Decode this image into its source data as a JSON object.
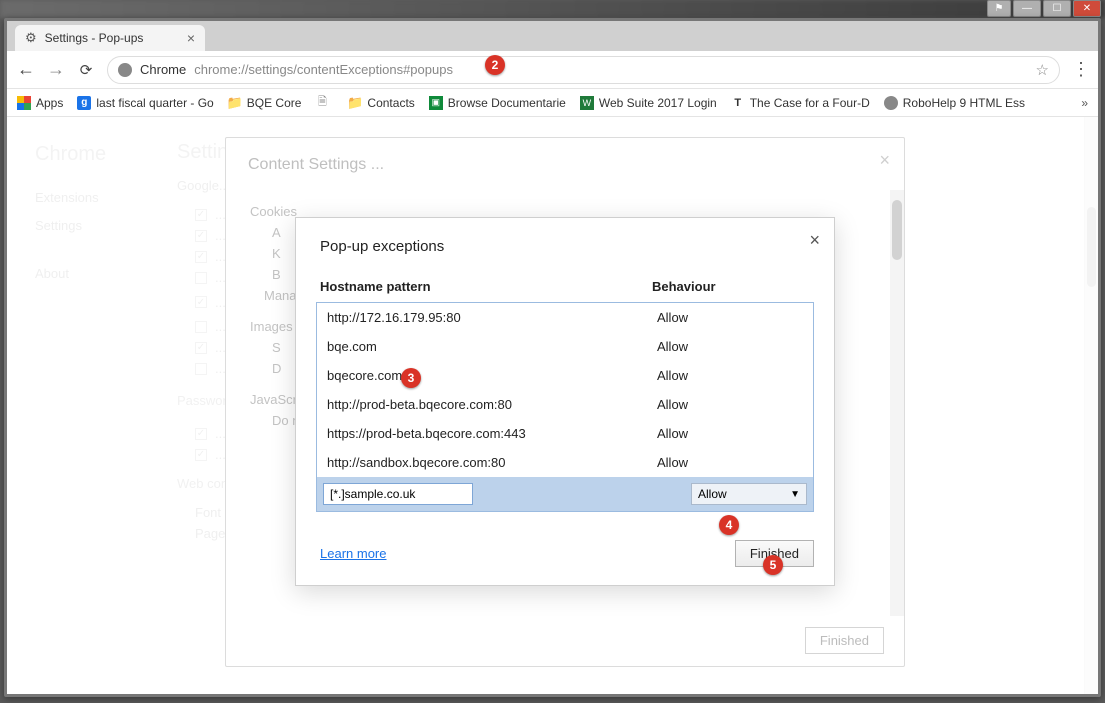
{
  "window_controls": {
    "user": "⚑",
    "min": "—",
    "max": "☐",
    "close": "✕"
  },
  "tab": {
    "title": "Settings - Pop-ups"
  },
  "nav": {
    "back": "←",
    "fwd": "→",
    "reload": "⟳"
  },
  "omnibox": {
    "label": "Chrome",
    "url": "chrome://settings/contentExceptions#popups",
    "star": "☆"
  },
  "menu_icon": "⋮",
  "bookmarks": {
    "apps": "Apps",
    "items": [
      "last fiscal quarter - Go",
      "BQE Core",
      "",
      "Contacts",
      "Browse Documentarie",
      "Web Suite 2017 Login",
      "The Case for a Four-D",
      "RoboHelp 9 HTML Ess"
    ],
    "overflow": "»"
  },
  "settings_bg": {
    "brand": "Chrome",
    "heading": "Settings",
    "nav": [
      "Extensions",
      "Settings",
      "About"
    ],
    "signin": "Google...",
    "sections": {
      "cookies": "Cookies",
      "images": "Images",
      "passwords": "Passwords",
      "javascript": "JavaScript",
      "webcon": "Web content",
      "fontsize": "Font size",
      "zoom": "Page zoom"
    },
    "manage": "Manage",
    "jsopt": "Do not allow any site to run JavaScript"
  },
  "modal1": {
    "title": "Content Settings ...",
    "cookies": "Cookies",
    "opts": [
      "A",
      "K",
      "B"
    ],
    "images": "Images",
    "img_opts": [
      "S",
      "D"
    ],
    "javascript": "JavaScript",
    "js_opt": "Do not allow any site to run JavaScript",
    "finished": "Finished"
  },
  "modal2": {
    "title": "Pop-up exceptions",
    "col_host": "Hostname pattern",
    "col_beh": "Behaviour",
    "rows": [
      {
        "host": "http://172.16.179.95:80",
        "beh": "Allow"
      },
      {
        "host": "bqe.com",
        "beh": "Allow"
      },
      {
        "host": "bqecore.com",
        "beh": "Allow"
      },
      {
        "host": "http://prod-beta.bqecore.com:80",
        "beh": "Allow"
      },
      {
        "host": "https://prod-beta.bqecore.com:443",
        "beh": "Allow"
      },
      {
        "host": "http://sandbox.bqecore.com:80",
        "beh": "Allow"
      }
    ],
    "new_value": "[*.]sample.co.uk",
    "new_select": "Allow",
    "learn": "Learn more",
    "submit": "Finished"
  },
  "annotations": {
    "a2": "2",
    "a3": "3",
    "a4": "4",
    "a5": "5"
  }
}
